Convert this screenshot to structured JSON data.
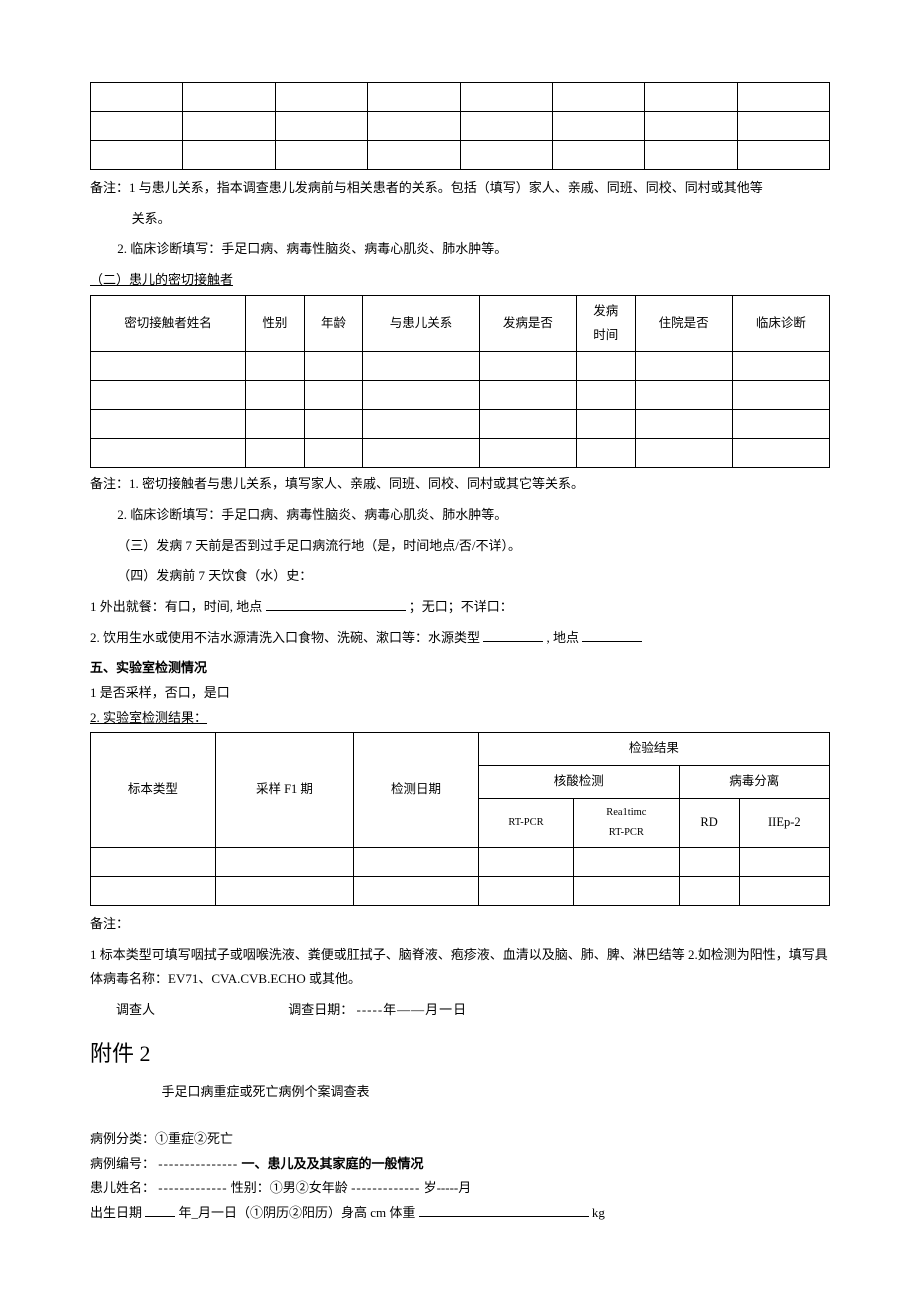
{
  "table1_cols": 8,
  "notes1": {
    "prefix": "备注：",
    "line1a": "1 与患儿关系，指本调查患儿发病前与相关患者的关系。包括（填写）家人、亲戚、同班、同校、同村或其他等",
    "line1b": "关系。",
    "line2": "2. 临床诊断填写：手足口病、病毒性脑炎、病毒心肌炎、肺水肿等。"
  },
  "contacts": {
    "heading": "（二）患儿的密切接触者",
    "headers": [
      "密切接触者姓名",
      "性别",
      "年龄",
      "与患儿关系",
      "发病是否",
      "发病\n时间",
      "住院是否",
      "临床诊断"
    ]
  },
  "notes2": {
    "prefix": "备注：",
    "line1": "1. 密切接触者与患儿关系，填写家人、亲戚、同班、同校、同村或其它等关系。",
    "line2": "2. 临床诊断填写：手足口病、病毒性脑炎、病毒心肌炎、肺水肿等。",
    "line3": "（三）发病 7 天前是否到过手足口病流行地（是，时间地点/否/不详）。",
    "line4": "（四）发病前 7 天饮食（水）史："
  },
  "diet": {
    "line1": "1 外出就餐：有口，时间, 地点",
    "line1_tail": "；无口；不详口：",
    "line2a": "2. 饮用生水或使用不洁水源清洗入口食物、洗碗、漱口等：水源类型",
    "line2b": ", 地点"
  },
  "lab": {
    "heading": "五、实验室检测情况",
    "line1": "1 是否采样，否口，是口",
    "line2": "2. 实验室检测结果：",
    "headers": {
      "col1": "标本类型",
      "col2": "采样 F1 期",
      "col3": "检测日期",
      "group": "检验结果",
      "sub1": "核酸检测",
      "sub2": "病毒分离",
      "c1": "RT-PCR",
      "c2": "Rea1timc\nRT-PCR",
      "c3": "RD",
      "c4": "IIEp-2"
    }
  },
  "notesLab": {
    "prefix": "备注：",
    "line1": "1 标本类型可填写咽拭子或咽喉洗液、粪便或肛拭子、脑脊液、疱疹液、血清以及脑、肺、脾、淋巴结等 2.如检测为阳性，填写具体病毒名称：EV71、CVA.CVB.ECHO 或其他。",
    "investigator": "调查人",
    "dateLabel": "调查日期：",
    "dateTail": "-----年——月一日"
  },
  "attachment": {
    "title": "附件 2",
    "subtitle": "手足口病重症或死亡病例个案调查表"
  },
  "caseInfo": {
    "line1": "病例分类：①重症②死亡",
    "line2a": "病例编号：",
    "line2dash": "---------------",
    "line2b": "一、患儿及及其家庭的一般情况",
    "line3a": "患儿姓名：",
    "line3dash1": "-------------",
    "line3b": "性别：①男②女年龄",
    "line3dash2": "-------------",
    "line3c": "岁-----月",
    "line4a": "出生日期",
    "line4b": "年_月一日（①阴历②阳历）身高 cm 体重",
    "line4c": "kg"
  }
}
